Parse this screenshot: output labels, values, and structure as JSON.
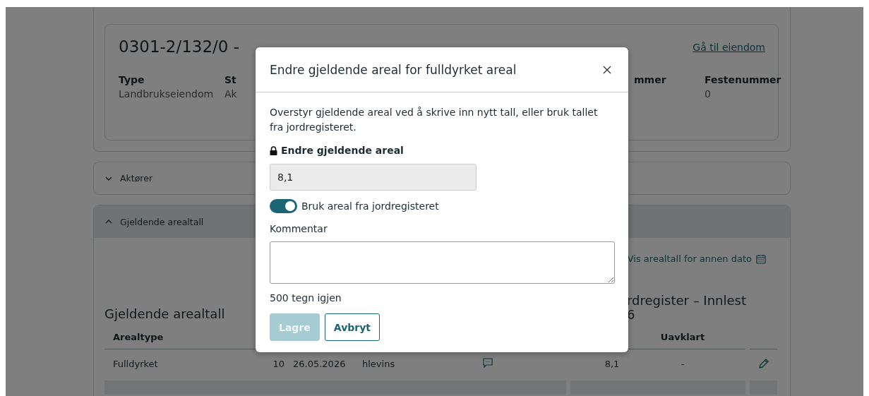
{
  "property": {
    "title": "0301-2/132/0 -",
    "link": "Gå til eiendom",
    "fields": [
      {
        "label": "Type",
        "value": "Landbrukseiendom"
      },
      {
        "label": "St",
        "value": "Ak"
      },
      {
        "label": "mmer"
      },
      {
        "label": "Festenummer",
        "value": "0"
      }
    ]
  },
  "sections": [
    {
      "title": "Aktører",
      "expanded": false
    },
    {
      "title": "Gjeldende arealtall",
      "expanded": true
    }
  ],
  "date_link": "Vis arealtall for annen dato",
  "current_table": {
    "title": "Gjeldende arealtall",
    "columns": [
      "Arealtype"
    ],
    "rows": [
      {
        "cells": [
          "Fulldyrket",
          "10",
          "26.05.2026",
          "hlevins"
        ]
      }
    ]
  },
  "register_table": {
    "title_lines": [
      "rdregister – Innlest",
      "6"
    ],
    "columns": [
      "",
      "Uavklart"
    ],
    "rows": [
      {
        "cells": [
          "8,1",
          "-"
        ]
      }
    ]
  },
  "modal": {
    "title": "Endre gjeldende areal for fulldyrket areal",
    "description": "Overstyr gjeldende areal ved å skrive inn nytt tall, eller bruk tallet fra jordregisteret.",
    "field_label": "Endre gjeldende areal",
    "locked": true,
    "field_value": "8,1",
    "toggle": {
      "label": "Bruk areal fra jordregisteret",
      "on": true
    },
    "comment_label": "Kommentar",
    "comment_counter": "500 tegn igjen",
    "buttons": [
      {
        "label": "Lagre",
        "disabled": true
      },
      {
        "label": "Avbryt",
        "disabled": false
      }
    ]
  }
}
